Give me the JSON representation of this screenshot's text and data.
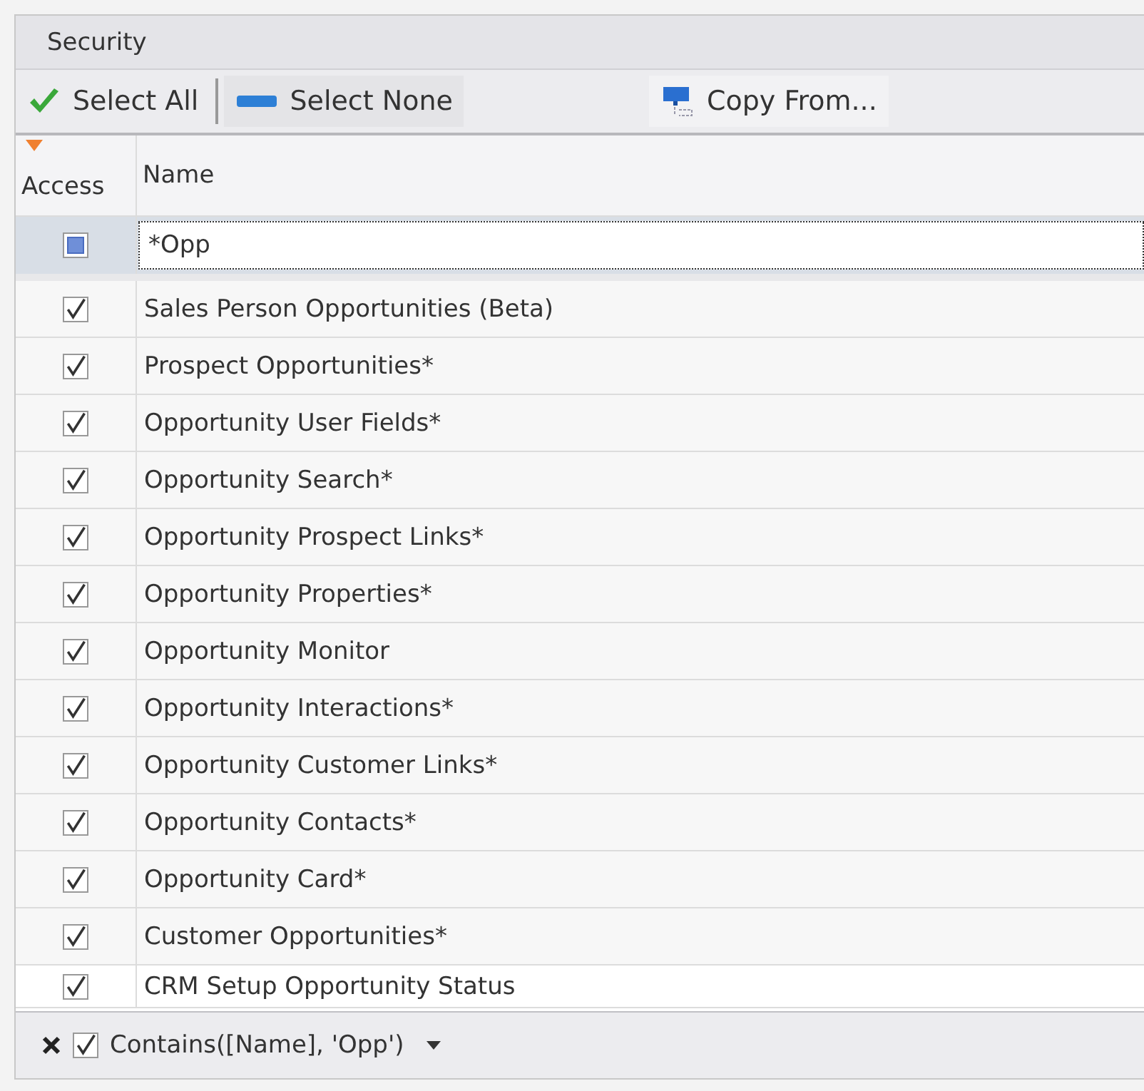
{
  "panel": {
    "title": "Security"
  },
  "toolbar": [
    {
      "kind": "select_all",
      "label": "Select All"
    },
    {
      "kind": "select_none",
      "label": "Select None"
    },
    {
      "kind": "copy_from",
      "label": "Copy From..."
    }
  ],
  "table": {
    "columns": [
      "Access",
      "Name"
    ],
    "filter_row": {
      "checked": false,
      "value": "*Opp"
    },
    "rows": [
      {
        "checked": true,
        "name": "Sales Person Opportunities (Beta)"
      },
      {
        "checked": true,
        "name": "Prospect Opportunities*"
      },
      {
        "checked": true,
        "name": "Opportunity User Fields*"
      },
      {
        "checked": true,
        "name": "Opportunity Search*"
      },
      {
        "checked": true,
        "name": "Opportunity Prospect Links*"
      },
      {
        "checked": true,
        "name": "Opportunity Properties*"
      },
      {
        "checked": true,
        "name": "Opportunity Monitor"
      },
      {
        "checked": true,
        "name": "Opportunity Interactions*"
      },
      {
        "checked": true,
        "name": "Opportunity Customer Links*"
      },
      {
        "checked": true,
        "name": "Opportunity Contacts*"
      },
      {
        "checked": true,
        "name": "Opportunity Card*"
      },
      {
        "checked": true,
        "name": "Customer Opportunities*"
      },
      {
        "checked": true,
        "name": "CRM Setup Opportunity Status"
      }
    ]
  },
  "filter_bar": {
    "enabled": true,
    "expression": "Contains([Name], 'Opp')"
  }
}
